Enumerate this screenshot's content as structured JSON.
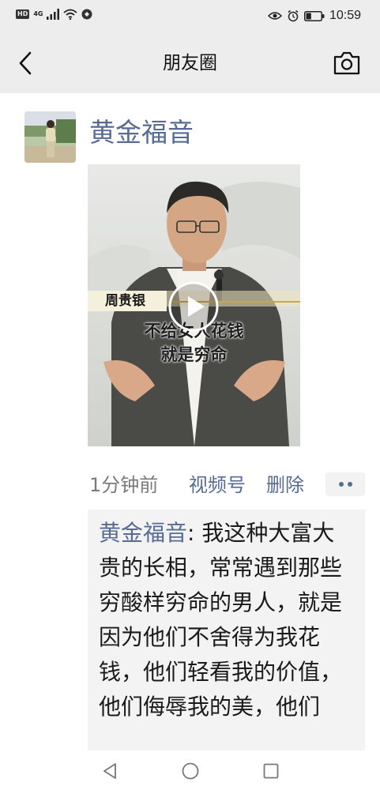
{
  "status_bar": {
    "hd_badge": "HD",
    "network": "4G",
    "time": "10:59",
    "battery_level": 0.35
  },
  "nav": {
    "title": "朋友圈",
    "back_icon": "chevron-left-icon",
    "camera_icon": "camera-icon"
  },
  "post": {
    "author": "黄金福音",
    "video": {
      "overlay_name": "周贵银",
      "overlay_caption_line1": "不给女人花钱",
      "overlay_caption_line2": "就是穷命",
      "play_icon": "play-icon"
    },
    "time": "1分钟前",
    "source_link": "视频号",
    "delete_label": "删除",
    "more_icon": "more-dots-icon",
    "comment": {
      "author": "黄金福音",
      "separator": ": ",
      "text": "我这种大富大贵的长相，常常遇到那些穷酸样穷命的男人，就是因为他们不舍得为我花钱，他们轻看我的价值，他们侮辱我的美，他们"
    }
  },
  "colors": {
    "link": "#576b95",
    "bar_background": "#ededed",
    "comment_background": "#f3f3f3"
  },
  "bottom_nav": {
    "back_icon": "triangle-back-icon",
    "home_icon": "circle-home-icon",
    "recents_icon": "square-recents-icon"
  }
}
